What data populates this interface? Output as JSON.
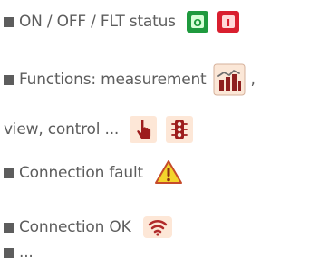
{
  "legend": {
    "status": {
      "label": "ON / OFF / FLT status",
      "on_glyph": "O",
      "off_glyph": "I",
      "on_color": "#1f9a3e",
      "off_color": "#d91f2f"
    },
    "functions": {
      "label": "Functions: measurement",
      "separator": ",",
      "continuation": "view, control ...",
      "measurement_icon": "bar-chart-icon",
      "view_icon": "hand-pointer-icon",
      "control_icon": "traffic-light-icon"
    },
    "fault": {
      "label": "Connection fault",
      "icon": "warning-icon"
    },
    "ok": {
      "label": "Connection OK",
      "icon": "wifi-icon"
    },
    "more": {
      "label": "..."
    }
  },
  "colors": {
    "text": "#5d5d5d",
    "icon_frame": "#c44a2c",
    "warning_fill": "#f4d42c",
    "warning_stroke": "#c64b2b"
  }
}
